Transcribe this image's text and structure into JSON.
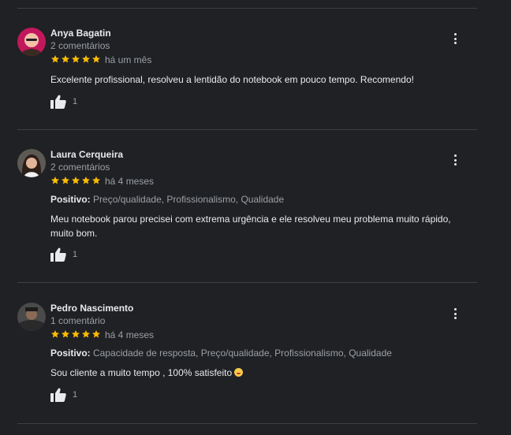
{
  "reviews": [
    {
      "name": "Anya Bagatin",
      "comments": "2 comentários",
      "rating": 5,
      "time": "há um mês",
      "positive_label": "",
      "positive": "",
      "text": "Excelente profissional, resolveu a lentidão do notebook em pouco tempo. Recomendo!",
      "likes": "1"
    },
    {
      "name": "Laura Cerqueira",
      "comments": "2 comentários",
      "rating": 5,
      "time": "há 4 meses",
      "positive_label": "Positivo:",
      "positive": "Preço/qualidade, Profissionalismo, Qualidade",
      "text": "Meu notebook parou precisei com extrema urgência  e ele resolveu meu problema muito rápido, muito bom.",
      "likes": "1"
    },
    {
      "name": "Pedro Nascimento",
      "comments": "1 comentário",
      "rating": 5,
      "time": "há 4 meses",
      "positive_label": "Positivo:",
      "positive": "Capacidade de resposta, Preço/qualidade, Profissionalismo, Qualidade",
      "text": "Sou cliente a muito tempo , 100% satisfeito",
      "likes": "1"
    }
  ],
  "colors": {
    "star": "#fbbc04",
    "background": "#202124",
    "divider": "#3c4043"
  }
}
